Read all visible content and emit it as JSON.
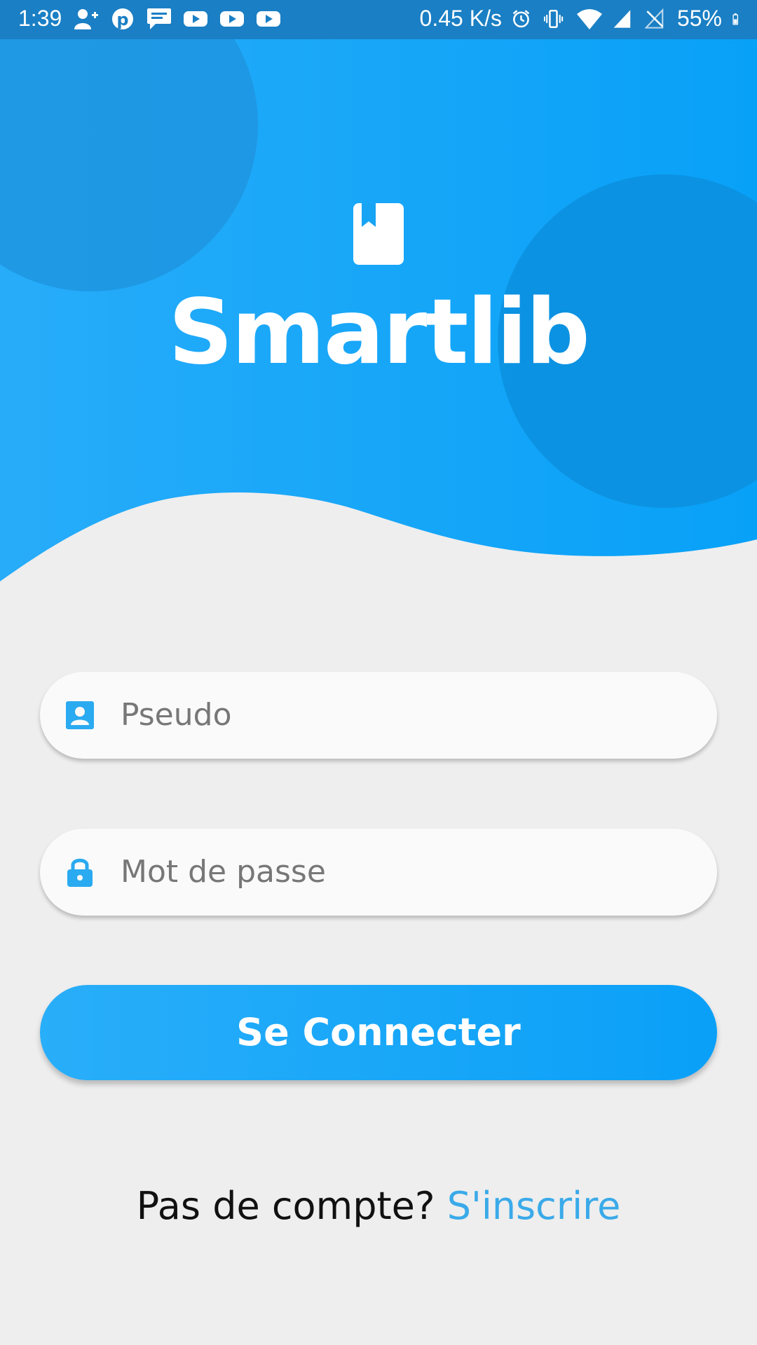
{
  "status_bar": {
    "time": "1:39",
    "left_icons": [
      "add-person-icon",
      "pinterest-icon",
      "message-icon",
      "youtube-icon",
      "youtube-icon",
      "youtube-icon"
    ],
    "network_speed": "0.45 K/s",
    "right_icons": [
      "alarm-icon",
      "vibrate-icon",
      "wifi-icon",
      "cell-signal-icon",
      "no-sim-icon"
    ],
    "battery_percent": "55%",
    "battery_icon": "battery-icon"
  },
  "header": {
    "logo_icon": "book-bookmark-icon",
    "app_title": "Smartlib",
    "colors": {
      "gradient_start": "#27acf9",
      "gradient_end": "#08a1f8",
      "circle_left": "#1e95e0",
      "circle_right": "#0c8fde"
    }
  },
  "form": {
    "username": {
      "icon": "user-card-icon",
      "placeholder": "Pseudo"
    },
    "password": {
      "icon": "lock-icon",
      "placeholder": "Mot de passe"
    },
    "submit_label": "Se Connecter"
  },
  "footer": {
    "prompt": "Pas de compte? ",
    "signup_link": "S'inscrire"
  },
  "colors": {
    "accent": "#29aef9",
    "link": "#3aaae9",
    "background": "#eeeeee",
    "field_background": "#fafafa",
    "placeholder": "#777777"
  }
}
